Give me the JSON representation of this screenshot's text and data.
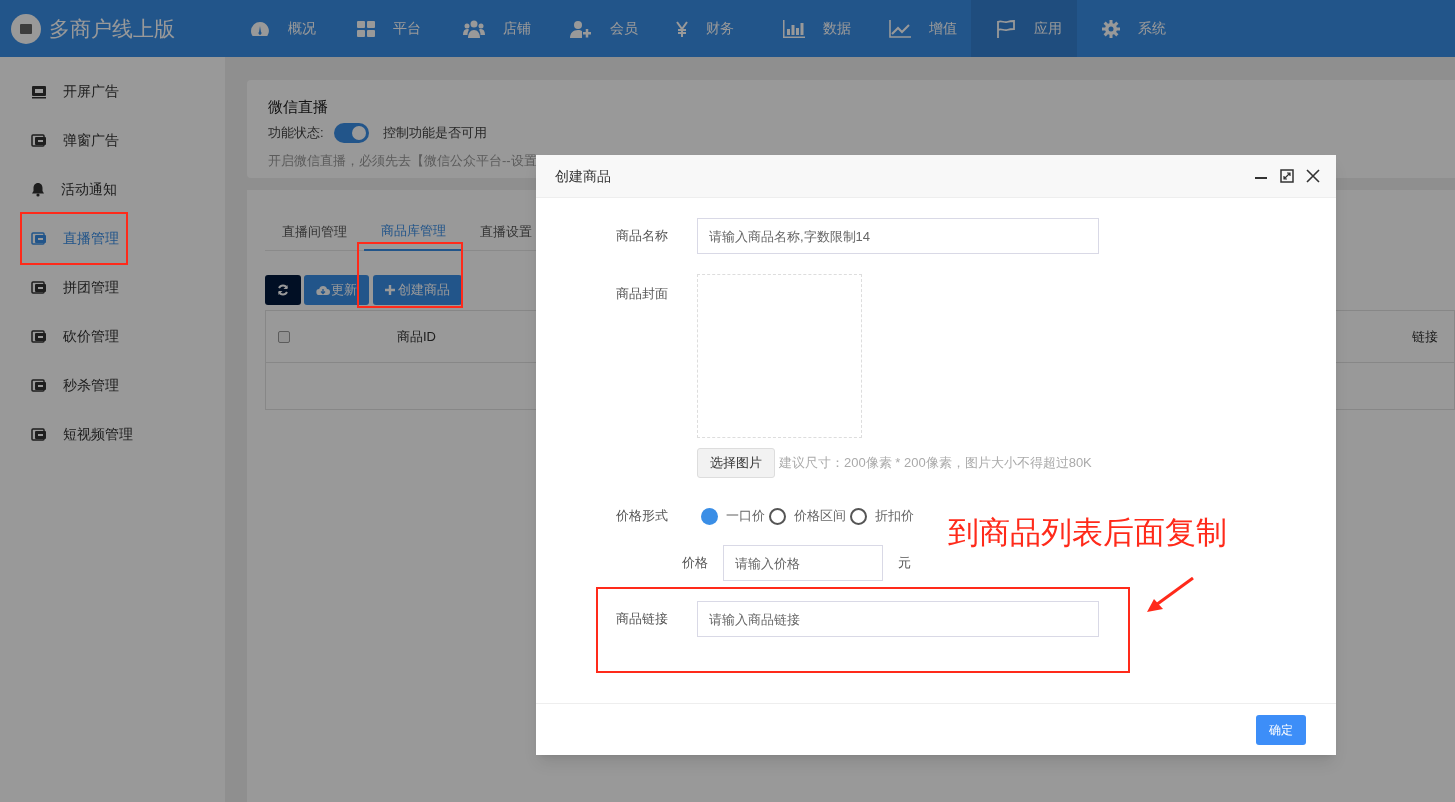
{
  "header": {
    "brand": "多商户线上版",
    "nav": [
      {
        "label": "概况",
        "kind": "gauge",
        "selected": false
      },
      {
        "label": "平台",
        "kind": "grid",
        "selected": false
      },
      {
        "label": "店铺",
        "kind": "users",
        "selected": false
      },
      {
        "label": "会员",
        "kind": "adduser",
        "selected": false
      },
      {
        "label": "财务",
        "kind": "yen",
        "selected": false
      },
      {
        "label": "数据",
        "kind": "bars",
        "selected": false
      },
      {
        "label": "增值",
        "kind": "trend",
        "selected": false
      },
      {
        "label": "应用",
        "kind": "flag",
        "selected": true
      },
      {
        "label": "系统",
        "kind": "gear",
        "selected": false
      }
    ]
  },
  "sidebar": {
    "items": [
      {
        "label": "开屏广告",
        "kind": "ad",
        "selected": false
      },
      {
        "label": "弹窗广告",
        "kind": "screen",
        "selected": false
      },
      {
        "label": "活动通知",
        "kind": "bell",
        "selected": false
      },
      {
        "label": "直播管理",
        "kind": "screen",
        "selected": true
      },
      {
        "label": "拼团管理",
        "kind": "screen",
        "selected": false
      },
      {
        "label": "砍价管理",
        "kind": "screen",
        "selected": false
      },
      {
        "label": "秒杀管理",
        "kind": "screen",
        "selected": false
      },
      {
        "label": "短视频管理",
        "kind": "screen",
        "selected": false
      }
    ]
  },
  "settings_card": {
    "title": "微信直播",
    "status_label": "功能状态:",
    "toggle": {
      "on": true
    },
    "toggle_hint": "控制功能是否可用",
    "notice": "开启微信直播，必须先去【微信公众平台--设置"
  },
  "tabs": [
    {
      "label": "直播间管理",
      "selected": false
    },
    {
      "label": "商品库管理",
      "selected": true
    },
    {
      "label": "直播设置",
      "selected": false
    }
  ],
  "toolbar": {
    "update_button": "更新",
    "create_button": "创建商品"
  },
  "table": {
    "columns": [
      "商品ID",
      "链接"
    ],
    "select_all": {
      "checked": false
    }
  },
  "dialog": {
    "title": "创建商品",
    "name_label": "商品名称",
    "name_placeholder": "请输入商品名称,字数限制14",
    "cover_label": "商品封面",
    "choose_button": "选择图片",
    "cover_hint": "建议尺寸：200像素 * 200像素，图片大小不得超过80K",
    "price_type_label": "价格形式",
    "price_types": [
      {
        "label": "一口价",
        "selected": true
      },
      {
        "label": "价格区间",
        "selected": false
      },
      {
        "label": "折扣价",
        "selected": false
      }
    ],
    "price_label": "价格",
    "price_placeholder": "请输入价格",
    "price_unit": "元",
    "link_label": "商品链接",
    "link_placeholder": "请输入商品链接",
    "confirm_button": "确定"
  },
  "annotation": {
    "text": "到商品列表后面复制"
  }
}
